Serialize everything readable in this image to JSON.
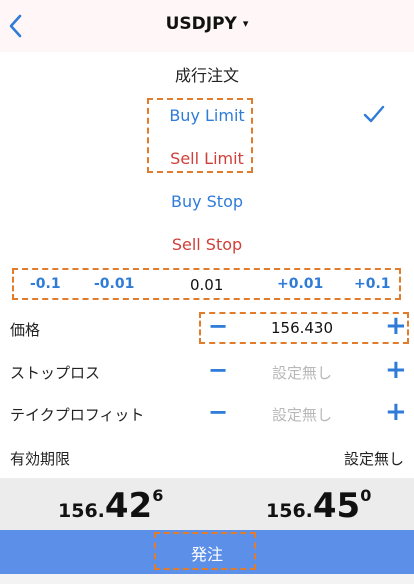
{
  "header": {
    "symbol": "USDJPY",
    "dropdown_icon": "▾"
  },
  "order_types": {
    "market": "成行注文",
    "buy_limit": "Buy Limit",
    "sell_limit": "Sell Limit",
    "buy_stop": "Buy Stop",
    "sell_stop": "Sell Stop",
    "selected": "Buy Limit"
  },
  "step_row": {
    "minus_0_1": "-0.1",
    "minus_0_01": "-0.01",
    "value": "0.01",
    "plus_0_01": "+0.01",
    "plus_0_1": "+0.1"
  },
  "form": {
    "price": {
      "label": "価格",
      "value": "156.430",
      "minus": "−",
      "plus": "+"
    },
    "stop_loss": {
      "label": "ストップロス",
      "value": "設定無し",
      "minus": "−",
      "plus": "+"
    },
    "take_profit": {
      "label": "テイクプロフィット",
      "value": "設定無し",
      "minus": "−",
      "plus": "+"
    },
    "expiration": {
      "label": "有効期限",
      "value": "設定無し"
    }
  },
  "quote": {
    "bid": {
      "prefix": "156.",
      "big": "42",
      "sup": "6"
    },
    "ask": {
      "prefix": "156.",
      "big": "45",
      "sup": "0"
    }
  },
  "submit": {
    "label": "発注"
  },
  "colors": {
    "accent_blue": "#2f7cd8",
    "sell_red": "#d0403a",
    "submit_bg": "#5c8fe8",
    "highlight_dash": "#e07c2c"
  }
}
